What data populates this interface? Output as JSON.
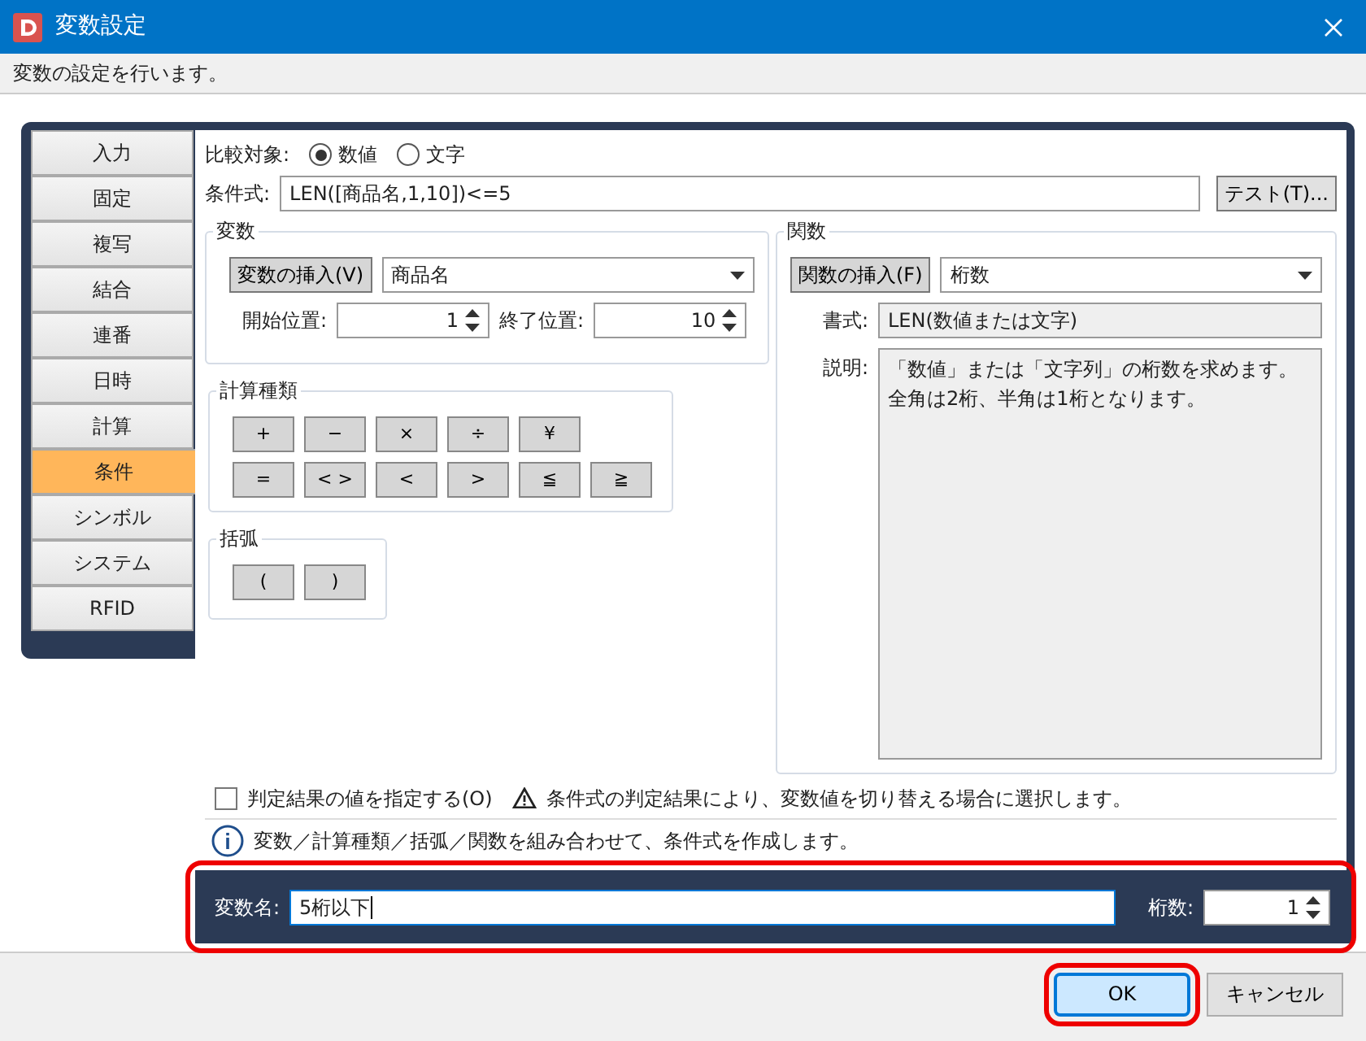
{
  "window": {
    "title": "変数設定",
    "description": "変数の設定を行います。"
  },
  "categories": [
    {
      "label": "入力",
      "selected": false
    },
    {
      "label": "固定",
      "selected": false
    },
    {
      "label": "複写",
      "selected": false
    },
    {
      "label": "結合",
      "selected": false
    },
    {
      "label": "連番",
      "selected": false
    },
    {
      "label": "日時",
      "selected": false
    },
    {
      "label": "計算",
      "selected": false
    },
    {
      "label": "条件",
      "selected": true
    },
    {
      "label": "シンボル",
      "selected": false
    },
    {
      "label": "システム",
      "selected": false
    },
    {
      "label": "RFID",
      "selected": false
    }
  ],
  "compare_target": {
    "label": "比較対象:",
    "options": [
      {
        "label": "数値",
        "selected": true
      },
      {
        "label": "文字",
        "selected": false
      }
    ]
  },
  "condition": {
    "label": "条件式:",
    "value": "LEN([商品名,1,10])<=5",
    "test_button": "テスト(T)..."
  },
  "variable_group": {
    "title": "変数",
    "insert_button": "変数の挿入(V)",
    "selected_variable": "商品名",
    "start_label": "開始位置:",
    "start_value": "1",
    "end_label": "終了位置:",
    "end_value": "10"
  },
  "operators_group": {
    "title": "計算種類",
    "rows": [
      [
        "+",
        "−",
        "×",
        "÷",
        "¥"
      ],
      [
        "=",
        "< >",
        "<",
        ">",
        "≦",
        "≧"
      ]
    ]
  },
  "brackets_group": {
    "title": "括弧",
    "buttons": [
      "(",
      ")"
    ]
  },
  "function_group": {
    "title": "関数",
    "insert_button": "関数の挿入(F)",
    "selected_function": "桁数",
    "format_label": "書式:",
    "format_value": "LEN(数値または文字)",
    "description_label": "説明:",
    "description": "「数値」または「文字列」の桁数を求めます。全角は2桁、半角は1桁となります。"
  },
  "result_option": {
    "label": "判定結果の値を指定する(O)",
    "checked": false,
    "note": "条件式の判定結果により、変数値を切り替える場合に選択します。"
  },
  "info": "変数／計算種類／括弧／関数を組み合わせて、条件式を作成します。",
  "variable_name": {
    "label": "変数名:",
    "value": "5桁以下",
    "highlighted": true
  },
  "digits": {
    "label": "桁数:",
    "value": "1"
  },
  "buttons": [
    {
      "label": "OK",
      "kind": "primary",
      "highlighted": true
    },
    {
      "label": "キャンセル",
      "kind": "secondary",
      "highlighted": false
    }
  ]
}
